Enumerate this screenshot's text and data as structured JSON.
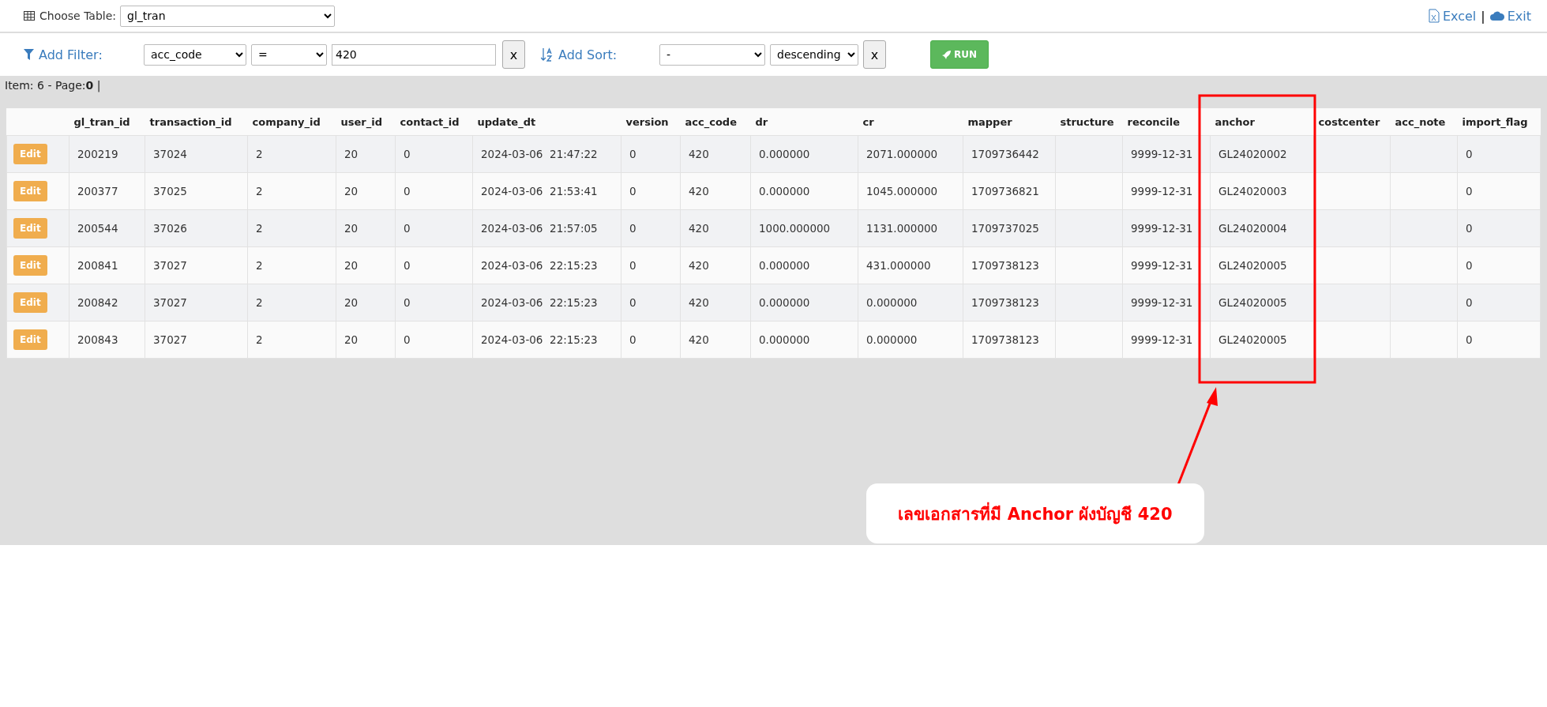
{
  "top_bar": {
    "choose_table_label": "Choose Table:",
    "table_value": "gl_tran",
    "links": [
      {
        "kind": "excel",
        "label": "Excel"
      },
      {
        "kind": "exit",
        "label": "Exit"
      }
    ],
    "separator": "|"
  },
  "filter_bar": {
    "filter_label": "Add Filter:",
    "filter_field": "acc_code",
    "filter_operator": "=",
    "filter_value": "420",
    "filter_clear": "x",
    "sort_label": "Add Sort:",
    "sort_field": "-",
    "sort_order": "descending",
    "sort_clear": "x",
    "run_label": "RUN"
  },
  "status": {
    "prefix": "Item: 6 - Page:",
    "page": "0",
    "suffix": "|"
  },
  "table": {
    "columns": [
      {
        "label": "gl_tran_id",
        "highlighted": false
      },
      {
        "label": "transaction_id",
        "highlighted": false
      },
      {
        "label": "company_id",
        "highlighted": false
      },
      {
        "label": "user_id",
        "highlighted": false
      },
      {
        "label": "contact_id",
        "highlighted": false
      },
      {
        "label": "update_dt",
        "highlighted": false
      },
      {
        "label": "version",
        "highlighted": false
      },
      {
        "label": "acc_code",
        "highlighted": false
      },
      {
        "label": "dr",
        "highlighted": false
      },
      {
        "label": "cr",
        "highlighted": false
      },
      {
        "label": "mapper",
        "highlighted": false
      },
      {
        "label": "structure",
        "highlighted": false
      },
      {
        "label": "reconcile",
        "highlighted": false
      },
      {
        "label": "anchor",
        "highlighted": true
      },
      {
        "label": "costcenter",
        "highlighted": false
      },
      {
        "label": "acc_note",
        "highlighted": false
      },
      {
        "label": "import_flag",
        "highlighted": false
      }
    ],
    "action_labels": [
      "Edit",
      "Edit",
      "Edit",
      "Edit",
      "Edit",
      "Edit"
    ],
    "rows": [
      [
        "200219",
        "37024",
        "2",
        "20",
        "0",
        "2024-03-06  21:47:22",
        "0",
        "420",
        "0.000000",
        "2071.000000",
        "1709736442",
        "",
        "9999-12-31",
        "GL24020002",
        "",
        "",
        "0"
      ],
      [
        "200377",
        "37025",
        "2",
        "20",
        "0",
        "2024-03-06  21:53:41",
        "0",
        "420",
        "0.000000",
        "1045.000000",
        "1709736821",
        "",
        "9999-12-31",
        "GL24020003",
        "",
        "",
        "0"
      ],
      [
        "200544",
        "37026",
        "2",
        "20",
        "0",
        "2024-03-06  21:57:05",
        "0",
        "420",
        "1000.000000",
        "1131.000000",
        "1709737025",
        "",
        "9999-12-31",
        "GL24020004",
        "",
        "",
        "0"
      ],
      [
        "200841",
        "37027",
        "2",
        "20",
        "0",
        "2024-03-06  22:15:23",
        "0",
        "420",
        "0.000000",
        "431.000000",
        "1709738123",
        "",
        "9999-12-31",
        "GL24020005",
        "",
        "",
        "0"
      ],
      [
        "200842",
        "37027",
        "2",
        "20",
        "0",
        "2024-03-06  22:15:23",
        "0",
        "420",
        "0.000000",
        "0.000000",
        "1709738123",
        "",
        "9999-12-31",
        "GL24020005",
        "",
        "",
        "0"
      ],
      [
        "200843",
        "37027",
        "2",
        "20",
        "0",
        "2024-03-06  22:15:23",
        "0",
        "420",
        "0.000000",
        "0.000000",
        "1709738123",
        "",
        "9999-12-31",
        "GL24020005",
        "",
        "",
        "0"
      ]
    ]
  },
  "annotation": {
    "text": "เลขเอกสารที่มี Anchor ผังบัญชี 420",
    "color": "#ff0000"
  }
}
